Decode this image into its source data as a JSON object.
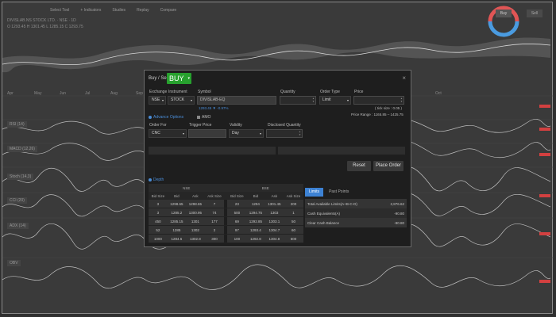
{
  "colors": {
    "buy": "#27a02e",
    "accent": "#3d82d4",
    "ring_red": "#e05555",
    "ring_blue": "#4a9be0"
  },
  "header": {
    "topbar_items": [
      "Select Tool",
      "+ Indicators",
      "Studies",
      "Replay",
      "Compare"
    ],
    "ohlc_line1": "DIVISLAB.NS STOCK LTD. · NSE · 1D",
    "ohlc_line2": "O 1293.45  H 1301.45  L 1285.15  C 1293.75"
  },
  "ring": {
    "buy_label": "Buy",
    "sell_label": "Sell"
  },
  "chart": {
    "months": [
      "Apr",
      "May",
      "Jun",
      "Jul",
      "Aug",
      "Sep",
      "Oct"
    ],
    "pane_labels": [
      "RSI (14)",
      "MACD (12,26)",
      "Stoch (14,3)",
      "CCI (20)",
      "ADX (14)",
      "OBV"
    ]
  },
  "order": {
    "title": "Buy / Sell",
    "side": "BUY",
    "labels": {
      "exchange": "Exchange",
      "instrument": "Instrument",
      "symbol": "Symbol",
      "quantity": "Quantity",
      "order_type": "Order Type",
      "price": "Price",
      "order_for": "Order For",
      "trigger_price": "Trigger Price",
      "validity": "Validity",
      "disclosed_quantity": "Disclosed Quantity"
    },
    "values": {
      "exchange": "NSE",
      "instrument": "STOCK",
      "symbol": "DIVISLAB-EQ",
      "quantity": "",
      "order_type": "Limit",
      "price": "",
      "order_for": "CNC",
      "trigger_price": "",
      "validity": "Day",
      "disclosed_quantity": ""
    },
    "tick_size": "( tick size : 0.05 )",
    "price_range": "Price Range : 1165.85 – 1425.75",
    "symbol_info": "1293.45  ▼ -0.97%",
    "advance_option": "Advance Options",
    "amo": "AMO",
    "reset_button": "Reset",
    "place_order_button": "Place Order",
    "depth_link": "Depth"
  },
  "depth": {
    "left_exchange": "NSE",
    "right_exchange": "BSE",
    "headers": [
      "Bid Size",
      "Bid",
      "Ask",
      "Ask Size"
    ],
    "left_rows": [
      [
        "3",
        "1298.65",
        "1298.65",
        "7"
      ],
      [
        "3",
        "1285.2",
        "1300.95",
        "74"
      ],
      [
        "450",
        "1285.15",
        "1301",
        "177"
      ],
      [
        "52",
        "1285",
        "1302",
        "2"
      ],
      [
        "1000",
        "1284.6",
        "1302.8",
        "300"
      ]
    ],
    "right_rows": [
      [
        "23",
        "1294",
        "1301.45",
        "200"
      ],
      [
        "500",
        "1294.75",
        "1303",
        "1"
      ],
      [
        "69",
        "1292.85",
        "1303.1",
        "50"
      ],
      [
        "97",
        "1293.4",
        "1304.7",
        "60"
      ],
      [
        "100",
        "1292.8",
        "1304.8",
        "600"
      ]
    ]
  },
  "funds": {
    "tabs": [
      "Limits",
      "Past Points"
    ],
    "rows": [
      {
        "label": "Total Available Limits(A+B-C-D)",
        "value": "2,876.62"
      },
      {
        "label": "Cash Equivalents(A)",
        "value": "-90.80"
      },
      {
        "label": "Clear Cash Balance",
        "value": "-90.80"
      }
    ]
  }
}
